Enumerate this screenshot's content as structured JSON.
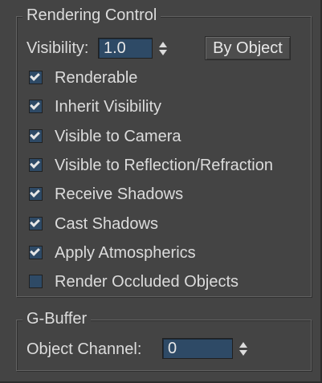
{
  "rendering_control": {
    "title": "Rendering Control",
    "visibility_label": "Visibility:",
    "visibility_value": "1.0",
    "by_object_label": "By Object",
    "checkboxes": [
      {
        "label": "Renderable",
        "checked": true
      },
      {
        "label": "Inherit Visibility",
        "checked": true
      },
      {
        "label": "Visible to Camera",
        "checked": true
      },
      {
        "label": "Visible to Reflection/Refraction",
        "checked": true
      },
      {
        "label": "Receive Shadows",
        "checked": true
      },
      {
        "label": "Cast Shadows",
        "checked": true
      },
      {
        "label": "Apply Atmospherics",
        "checked": true
      },
      {
        "label": "Render Occluded Objects",
        "checked": false
      }
    ]
  },
  "gbuffer": {
    "title": "G-Buffer",
    "object_channel_label": "Object Channel:",
    "object_channel_value": "0"
  },
  "colors": {
    "background": "#444444",
    "field": "#2e4a66",
    "text": "#dcdcdc"
  }
}
